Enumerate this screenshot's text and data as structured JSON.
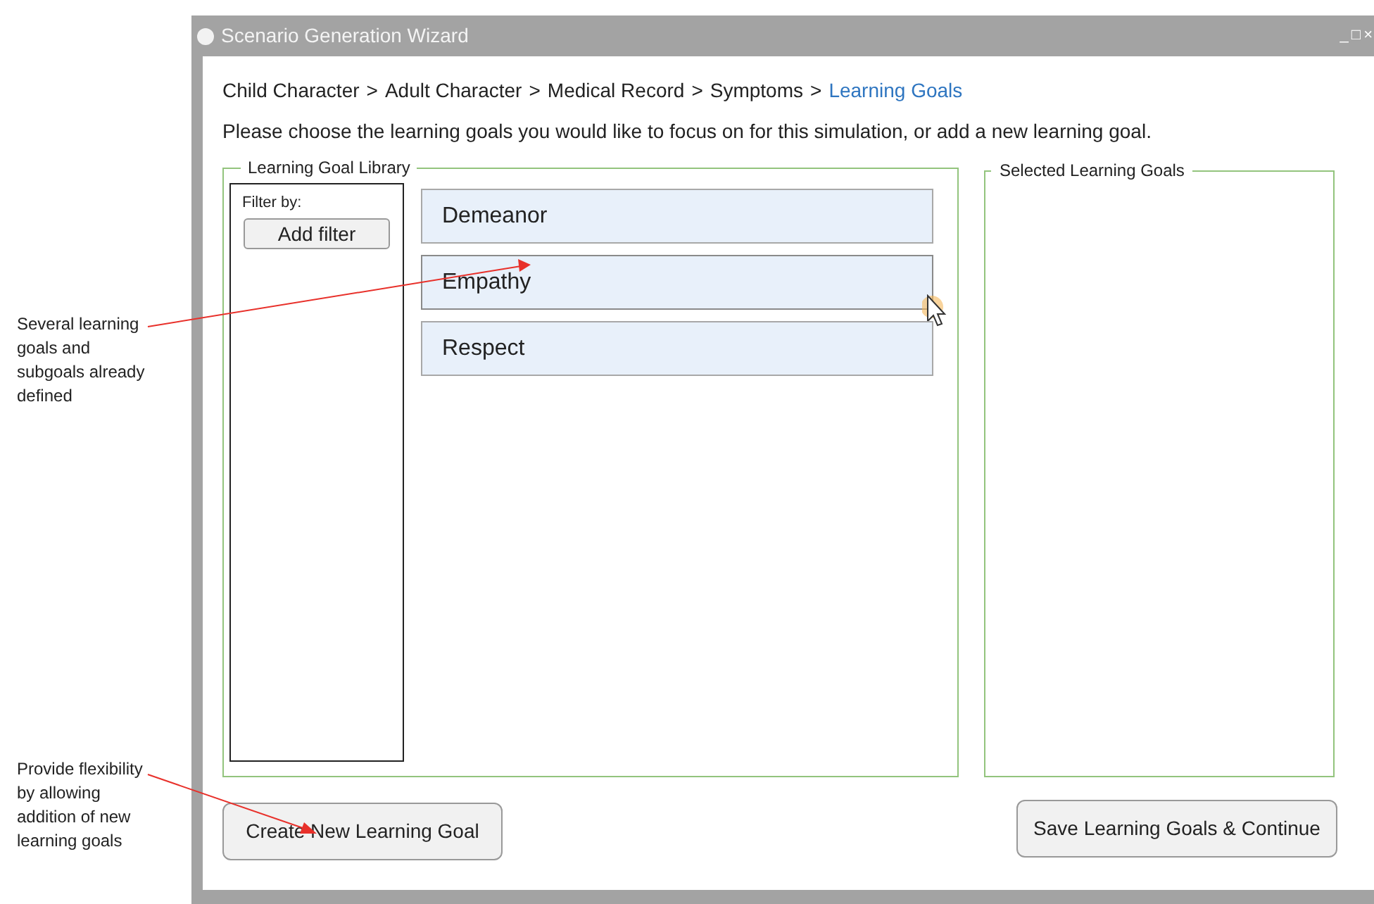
{
  "annotations": [
    {
      "text": "Several learning goals and subgoals already defined"
    },
    {
      "text": "Provide flexibility by allowing addition of new learning goals"
    }
  ],
  "window": {
    "title": "Scenario Generation Wizard",
    "controls": [
      "_",
      "□",
      "×"
    ]
  },
  "breadcrumb": [
    {
      "kind": "crumb",
      "label": "Child Character",
      "current": false
    },
    {
      "kind": "separator",
      "label": ">"
    },
    {
      "kind": "crumb",
      "label": "Adult Character",
      "current": false
    },
    {
      "kind": "separator",
      "label": ">"
    },
    {
      "kind": "crumb",
      "label": "Medical Record",
      "current": false
    },
    {
      "kind": "separator",
      "label": ">"
    },
    {
      "kind": "crumb",
      "label": "Symptoms",
      "current": false
    },
    {
      "kind": "separator",
      "label": ">"
    },
    {
      "kind": "crumb",
      "label": "Learning Goals",
      "current": true
    }
  ],
  "instructions": "Please choose the learning goals you would like to focus on for this simulation, or add a new learning goal.",
  "library": {
    "title": "Learning Goal Library",
    "filter_label": "Filter by:",
    "filter_button": "Add filter",
    "goals": [
      {
        "label": "Demeanor",
        "hovered": false
      },
      {
        "label": "Empathy",
        "hovered": true
      },
      {
        "label": "Respect",
        "hovered": false
      }
    ]
  },
  "selected": {
    "title": "Selected Learning Goals"
  },
  "buttons": {
    "create": "Create New Learning Goal",
    "save": "Save Learning Goals & Continue"
  }
}
